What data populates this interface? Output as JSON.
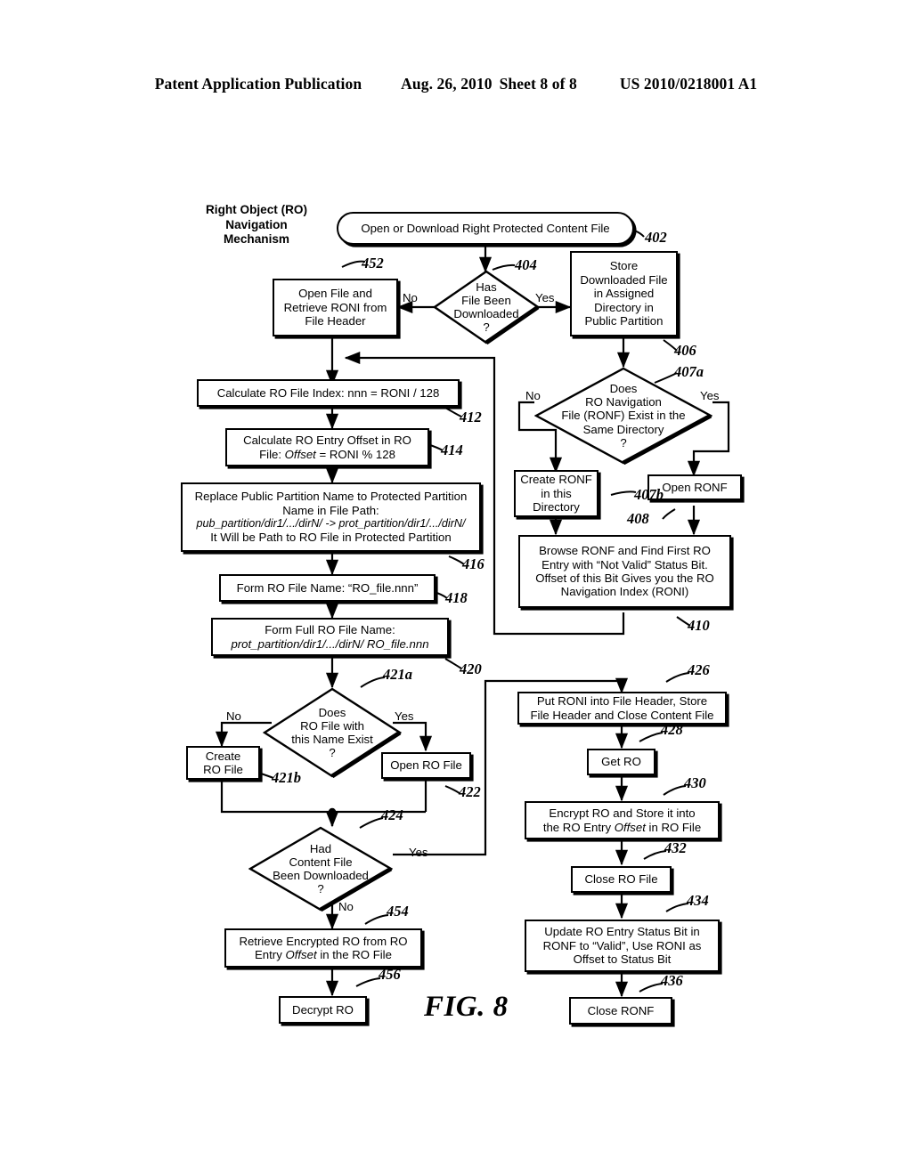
{
  "header": {
    "publication": "Patent Application Publication",
    "date": "Aug. 26, 2010",
    "sheet": "Sheet 8 of 8",
    "number": "US 2010/0218001 A1"
  },
  "figure": {
    "caption": "FIG. 8",
    "title": "Right Object (RO)\nNavigation\nMechanism"
  },
  "chart_data": {
    "type": "diagram",
    "diagram_kind": "flowchart",
    "title": "Right Object (RO) Navigation Mechanism",
    "nodes": [
      {
        "id": "402",
        "shape": "terminator",
        "text": "Open or Download Right Protected Content File"
      },
      {
        "id": "404",
        "shape": "decision",
        "text": "Has File Been Downloaded ?"
      },
      {
        "id": "452",
        "shape": "process",
        "text": "Open File and Retrieve RONI from File Header"
      },
      {
        "id": "406",
        "shape": "process",
        "text": "Store Downloaded File in Assigned Directory in Public Partition"
      },
      {
        "id": "407a",
        "shape": "decision",
        "text": "Does RO Navigation File (RONF) Exist in the Same Directory ?"
      },
      {
        "id": "407b",
        "shape": "process",
        "text": "Create RONF in this Directory"
      },
      {
        "id": "408",
        "shape": "process",
        "text": "Open RONF"
      },
      {
        "id": "410",
        "shape": "process",
        "text": "Browse RONF and Find First RO Entry with “Not Valid” Status Bit. Offset of this Bit Gives you the RO Navigation Index (RONI)"
      },
      {
        "id": "412",
        "shape": "process",
        "text": "Calculate RO File Index: nnn = RONI / 128"
      },
      {
        "id": "414",
        "shape": "process",
        "text": "Calculate RO Entry Offset in RO File: Offset = RONI % 128"
      },
      {
        "id": "416",
        "shape": "process",
        "text": "Replace Public Partition Name to Protected Partition Name in File Path: pub_partition/dir1/.../dirN/ -> prot_partition/dir1/.../dirN/ It Will be Path to RO File in Protected Partition"
      },
      {
        "id": "418",
        "shape": "process",
        "text": "Form RO File Name: “RO_file.nnn”"
      },
      {
        "id": "420",
        "shape": "process",
        "text": "Form Full RO File Name: prot_partition/dir1/.../dirN/ RO_file.nnn"
      },
      {
        "id": "421a",
        "shape": "decision",
        "text": "Does RO File with this Name Exist ?"
      },
      {
        "id": "421b",
        "shape": "process",
        "text": "Create RO File"
      },
      {
        "id": "422",
        "shape": "process",
        "text": "Open RO File"
      },
      {
        "id": "424",
        "shape": "decision",
        "text": "Had Content File Been Downloaded ?"
      },
      {
        "id": "454",
        "shape": "process",
        "text": "Retrieve Encrypted RO from RO Entry Offset in the RO File"
      },
      {
        "id": "456",
        "shape": "process",
        "text": "Decrypt RO"
      },
      {
        "id": "426",
        "shape": "process",
        "text": "Put RONI into File Header, Store File Header and Close Content File"
      },
      {
        "id": "428",
        "shape": "process",
        "text": "Get RO"
      },
      {
        "id": "430",
        "shape": "process",
        "text": "Encrypt RO and Store it into the RO Entry Offset in RO File"
      },
      {
        "id": "432",
        "shape": "process",
        "text": "Close RO File"
      },
      {
        "id": "434",
        "shape": "process",
        "text": "Update RO Entry Status Bit in RONF to “Valid”, Use RONI as Offset to Status Bit"
      },
      {
        "id": "436",
        "shape": "process",
        "text": "Close RONF"
      }
    ],
    "edges": [
      {
        "from": "402",
        "to": "404",
        "label": ""
      },
      {
        "from": "404",
        "to": "452",
        "label": "No"
      },
      {
        "from": "404",
        "to": "406",
        "label": "Yes"
      },
      {
        "from": "452",
        "to": "412",
        "label": ""
      },
      {
        "from": "406",
        "to": "407a",
        "label": ""
      },
      {
        "from": "407a",
        "to": "407b",
        "label": "No"
      },
      {
        "from": "407a",
        "to": "408",
        "label": "Yes"
      },
      {
        "from": "407b",
        "to": "410",
        "label": ""
      },
      {
        "from": "408",
        "to": "410",
        "label": ""
      },
      {
        "from": "410",
        "to": "412",
        "label": ""
      },
      {
        "from": "412",
        "to": "414",
        "label": ""
      },
      {
        "from": "414",
        "to": "416",
        "label": ""
      },
      {
        "from": "416",
        "to": "418",
        "label": ""
      },
      {
        "from": "418",
        "to": "420",
        "label": ""
      },
      {
        "from": "420",
        "to": "421a",
        "label": ""
      },
      {
        "from": "421a",
        "to": "421b",
        "label": "No"
      },
      {
        "from": "421a",
        "to": "422",
        "label": "Yes"
      },
      {
        "from": "421b",
        "to": "424",
        "label": ""
      },
      {
        "from": "422",
        "to": "424",
        "label": ""
      },
      {
        "from": "424",
        "to": "454",
        "label": "No"
      },
      {
        "from": "424",
        "to": "426",
        "label": "Yes"
      },
      {
        "from": "454",
        "to": "456",
        "label": ""
      },
      {
        "from": "426",
        "to": "428",
        "label": ""
      },
      {
        "from": "428",
        "to": "430",
        "label": ""
      },
      {
        "from": "430",
        "to": "432",
        "label": ""
      },
      {
        "from": "432",
        "to": "434",
        "label": ""
      },
      {
        "from": "434",
        "to": "436",
        "label": ""
      }
    ]
  },
  "nodes": {
    "n402": {
      "l1": "Open or Download Right Protected Content File"
    },
    "n404": {
      "l1": "Has",
      "l2": "File Been",
      "l3": "Downloaded",
      "l4": "?"
    },
    "n452": {
      "l1": "Open File and",
      "l2": "Retrieve RONI from",
      "l3": "File Header"
    },
    "n406": {
      "l1": "Store",
      "l2": "Downloaded File",
      "l3": "in Assigned",
      "l4": "Directory in",
      "l5": "Public Partition"
    },
    "n407a": {
      "l1": "Does",
      "l2": "RO Navigation",
      "l3": "File (RONF) Exist in the",
      "l4": "Same Directory",
      "l5": "?"
    },
    "n407b": {
      "l1": "Create RONF",
      "l2": "in this",
      "l3": "Directory"
    },
    "n408": {
      "l1": "Open RONF"
    },
    "n410": {
      "l1": "Browse RONF and Find First RO",
      "l2": "Entry with “Not Valid” Status Bit.",
      "l3": "Offset of this Bit Gives you the RO",
      "l4": "Navigation Index (RONI)"
    },
    "n412": {
      "l1": "Calculate RO File Index: nnn = RONI / 128"
    },
    "n414": {
      "l1": "Calculate RO Entry Offset in RO",
      "l2a": "File: ",
      "l2b": "Offset",
      "l2c": " = RONI % 128"
    },
    "n416": {
      "l1": "Replace Public Partition Name to Protected Partition",
      "l2": "Name in File Path:",
      "l3": "pub_partition/dir1/.../dirN/ -> prot_partition/dir1/.../dirN/",
      "l4": "It Will be Path to RO File in Protected Partition"
    },
    "n418": {
      "l1": "Form RO File Name: “RO_file.nnn”"
    },
    "n420": {
      "l1": "Form Full RO File Name:",
      "l2": "prot_partition/dir1/.../dirN/ RO_file.nnn"
    },
    "n421a": {
      "l1": "Does",
      "l2": "RO File with",
      "l3": "this Name Exist",
      "l4": "?"
    },
    "n421b": {
      "l1": "Create",
      "l2": "RO File"
    },
    "n422": {
      "l1": "Open RO File"
    },
    "n424": {
      "l1": "Had",
      "l2": "Content File",
      "l3": "Been Downloaded",
      "l4": "?"
    },
    "n454": {
      "l1": "Retrieve Encrypted RO from RO",
      "l2a": "Entry ",
      "l2b": "Offset",
      "l2c": " in the RO File"
    },
    "n456": {
      "l1": "Decrypt RO"
    },
    "n426": {
      "l1": "Put RONI into File Header, Store",
      "l2": "File Header and Close Content File"
    },
    "n428": {
      "l1": "Get RO"
    },
    "n430": {
      "l1": "Encrypt RO and Store it into",
      "l2a": "the RO Entry ",
      "l2b": "Offset",
      "l2c": " in RO File"
    },
    "n432": {
      "l1": "Close RO File"
    },
    "n434": {
      "l1": "Update RO Entry Status Bit in",
      "l2": "RONF to “Valid”, Use RONI as",
      "l3": "Offset to Status Bit"
    },
    "n436": {
      "l1": "Close RONF"
    }
  },
  "refs": {
    "r402": "402",
    "r404": "404",
    "r452": "452",
    "r406": "406",
    "r407a": "407a",
    "r407b": "407b",
    "r408": "408",
    "r410": "410",
    "r412": "412",
    "r414": "414",
    "r416": "416",
    "r418": "418",
    "r420": "420",
    "r421a": "421a",
    "r421b": "421b",
    "r422": "422",
    "r424": "424",
    "r454": "454",
    "r456": "456",
    "r426": "426",
    "r428": "428",
    "r430": "430",
    "r432": "432",
    "r434": "434",
    "r436": "436"
  },
  "edge_labels": {
    "e404_no": "No",
    "e404_yes": "Yes",
    "e407_no": "No",
    "e407_yes": "Yes",
    "e421_no": "No",
    "e421_yes": "Yes",
    "e424_yes": "Yes",
    "e424_no": "No"
  }
}
